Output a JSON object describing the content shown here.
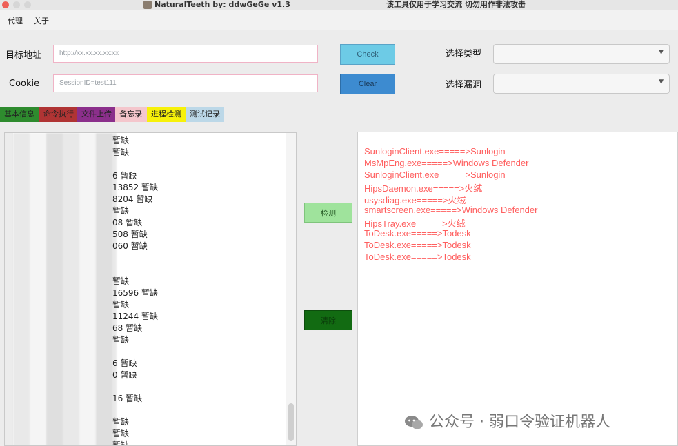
{
  "window": {
    "title": "NaturalTeeth  by: ddwGeGe v1.3",
    "notice": "该工具仅用于学习交流 切勿用作非法攻击"
  },
  "menu": [
    "代理",
    "关于"
  ],
  "form": {
    "target_label": "目标地址",
    "target_placeholder": "http://xx.xx.xx.xx:xx",
    "cookie_label": "Cookie",
    "cookie_placeholder": "SessionID=test111",
    "check_button": "Check",
    "clear_button": "Clear",
    "type_label": "选择类型",
    "type_value": "",
    "vuln_label": "选择漏洞",
    "vuln_value": ""
  },
  "tabs": [
    {
      "label": "基本信息",
      "color": "#2e8b2e"
    },
    {
      "label": "命令执行",
      "color": "#b03434"
    },
    {
      "label": "文件上传",
      "color": "#8b2f8b"
    },
    {
      "label": "备忘录",
      "color": "#f4c6cc"
    },
    {
      "label": "进程检测",
      "color": "#f7f10a"
    },
    {
      "label": "测试记录",
      "color": "#bcd8e8"
    }
  ],
  "process_list": [
    "暂缺",
    "暂缺",
    "",
    "6 暂缺",
    "13852 暂缺",
    "8204 暂缺",
    "暂缺",
    "08 暂缺",
    "508 暂缺",
    "060 暂缺",
    "",
    "",
    "暂缺",
    "16596 暂缺",
    "暂缺",
    "11244 暂缺",
    "68 暂缺",
    "暂缺",
    "",
    "6 暂缺",
    "0 暂缺",
    "",
    "16 暂缺",
    "",
    "暂缺",
    "暂缺",
    "暂缺"
  ],
  "actions": {
    "detect_button": "检测",
    "clear_button": "清除"
  },
  "results": [
    "SunloginClient.exe=====>Sunlogin",
    "MsMpEng.exe=====>Windows Defender",
    "SunloginClient.exe=====>Sunlogin",
    "HipsDaemon.exe=====>火绒",
    "usysdiag.exe=====>火绒",
    "smartscreen.exe=====>Windows Defender",
    "HipsTray.exe=====>火绒",
    "ToDesk.exe=====>Todesk",
    "ToDesk.exe=====>Todesk",
    "ToDesk.exe=====>Todesk"
  ],
  "watermark": "公众号 · 弱口令验证机器人",
  "icons": [
    "app-icon",
    "caret-down-icon",
    "wechat-icon"
  ]
}
